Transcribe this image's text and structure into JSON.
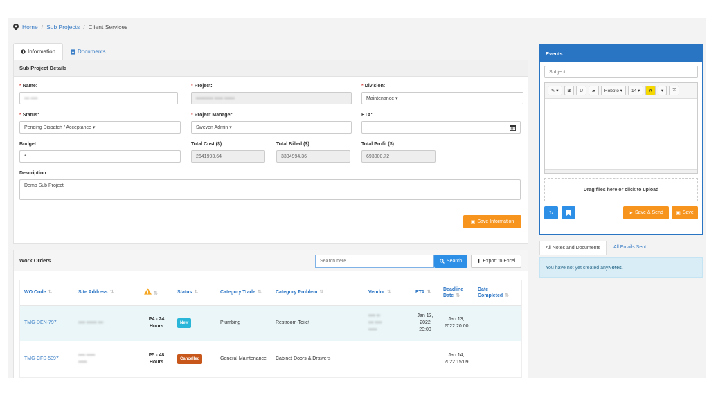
{
  "breadcrumb": {
    "home": "Home",
    "sub_projects": "Sub Projects",
    "current": "Client Services",
    "sep": "/"
  },
  "tabs": [
    {
      "label": "Information"
    },
    {
      "label": "Documents"
    }
  ],
  "details": {
    "title": "Sub Project Details",
    "name_label": "Name:",
    "project_label": "Project:",
    "division_label": "Division:",
    "division_value": "Maintenance",
    "status_label": "Status:",
    "status_value": "Pending Dispatch / Acceptance",
    "pm_label": "Project Manager:",
    "pm_value": "Sweven Admin",
    "eta_label": "ETA:",
    "budget_label": "Budget:",
    "budget_value": "*",
    "total_cost_label": "Total Cost ($):",
    "total_cost_value": "2641993.64",
    "total_billed_label": "Total Billed ($):",
    "total_billed_value": "3334994.36",
    "total_profit_label": "Total Profit ($):",
    "total_profit_value": "693000.72",
    "description_label": "Description:",
    "description_value": "Demo Sub Project",
    "save_button": "Save Information",
    "required_mark": "*"
  },
  "work_orders": {
    "title": "Work Orders",
    "search_placeholder": "Search here...",
    "search_button": "Search",
    "export_button": "Export to Excel",
    "columns": {
      "wo_code": "WO Code",
      "site_address": "Site Address",
      "status": "Status",
      "category_trade": "Category Trade",
      "category_problem": "Category Problem",
      "vendor": "Vendor",
      "eta": "ETA",
      "deadline": "Deadline Date",
      "completed": "Date Completed"
    },
    "rows": [
      {
        "code": "TMG-DEN-797",
        "priority": "P4 - 24 Hours",
        "status": "New",
        "trade": "Plumbing",
        "problem": "Restroom-Toilet",
        "eta": "Jan 13, 2022 20:00",
        "deadline": "Jan 13, 2022 20:00"
      },
      {
        "code": "TMG-CFS-5097",
        "priority": "P5 - 48 Hours",
        "status": "Cancelled",
        "trade": "General Maintenance",
        "problem": "Cabinet Doors & Drawers",
        "eta": "",
        "deadline": "Jan 14, 2022 15:09"
      }
    ]
  },
  "events": {
    "title": "Events",
    "subject_placeholder": "Subject",
    "font_name": "Roboto",
    "font_size": "14",
    "bold": "B",
    "underline": "U",
    "highlight": "A",
    "upload_text": "Drag files here or click to upload",
    "save_send_button": "Save & Send",
    "save_button": "Save"
  },
  "notes": {
    "tab_all_notes": "All Notes and Documents",
    "tab_all_emails": "All Emails Sent",
    "empty_prefix": "You have not yet created any ",
    "empty_bold": "Notes",
    "empty_suffix": "."
  },
  "colors": {
    "primary": "#2a74c4",
    "orange": "#f7941d",
    "badge_new": "#29b6d8",
    "badge_cancelled": "#c8571b",
    "warning_icon": "#f5a623"
  }
}
